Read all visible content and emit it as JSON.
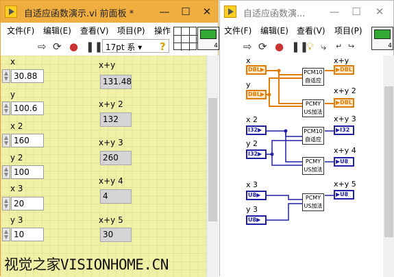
{
  "front_panel": {
    "title": "自适应函数演示.vi 前面板 *",
    "menus": [
      "文件(F)",
      "编辑(E)",
      "查看(V)",
      "项目(P)",
      "操作"
    ],
    "font_selector": "17pt 系",
    "connector_label": "4",
    "controls": [
      {
        "label": "x",
        "value": "30.88"
      },
      {
        "label": "y",
        "value": "100.6"
      },
      {
        "label": "x 2",
        "value": "160"
      },
      {
        "label": "y 2",
        "value": "100"
      },
      {
        "label": "x 3",
        "value": "20"
      },
      {
        "label": "y 3",
        "value": "10"
      }
    ],
    "indicators": [
      {
        "label": "x+y",
        "value": "131.48"
      },
      {
        "label": "x+y 2",
        "value": "132"
      },
      {
        "label": "x+y 3",
        "value": "260"
      },
      {
        "label": "x+y 4",
        "value": "4"
      },
      {
        "label": "x+y 5",
        "value": "30"
      }
    ],
    "colors": {
      "title_bar": "#f0ae41",
      "panel": "#f1f0a7"
    }
  },
  "block_diagram": {
    "title": "自适应函数演...",
    "menus": [
      "文件(F)",
      "编辑(E)",
      "查看(V)",
      "项目(P)"
    ],
    "connector_label": "4",
    "inputs": [
      {
        "label": "x",
        "type": "DBL"
      },
      {
        "label": "y",
        "type": "DBL"
      },
      {
        "label": "x 2",
        "type": "I32"
      },
      {
        "label": "y 2",
        "type": "I32"
      },
      {
        "label": "x 3",
        "type": "U8"
      },
      {
        "label": "y 3",
        "type": "U8"
      }
    ],
    "outputs": [
      {
        "label": "x+y",
        "type": "DBL"
      },
      {
        "label": "x+y 2",
        "type": "DBL"
      },
      {
        "label": "x+y 3",
        "type": "I32"
      },
      {
        "label": "x+y 4",
        "type": "U8"
      },
      {
        "label": "x+y 5",
        "type": "U8"
      }
    ],
    "nodes": [
      {
        "top": "PCM10",
        "bottom": "自适应"
      },
      {
        "top": "PCMY",
        "bottom": "US加法"
      },
      {
        "top": "PCM10",
        "bottom": "自适应"
      },
      {
        "top": "PCMY",
        "bottom": "US加法"
      },
      {
        "top": "PCMY",
        "bottom": "US加法"
      }
    ],
    "colors": {
      "dbl": "#e07b00",
      "int": "#1f1fa6"
    }
  },
  "watermark": "视觉之家VISIONHOME.CN"
}
